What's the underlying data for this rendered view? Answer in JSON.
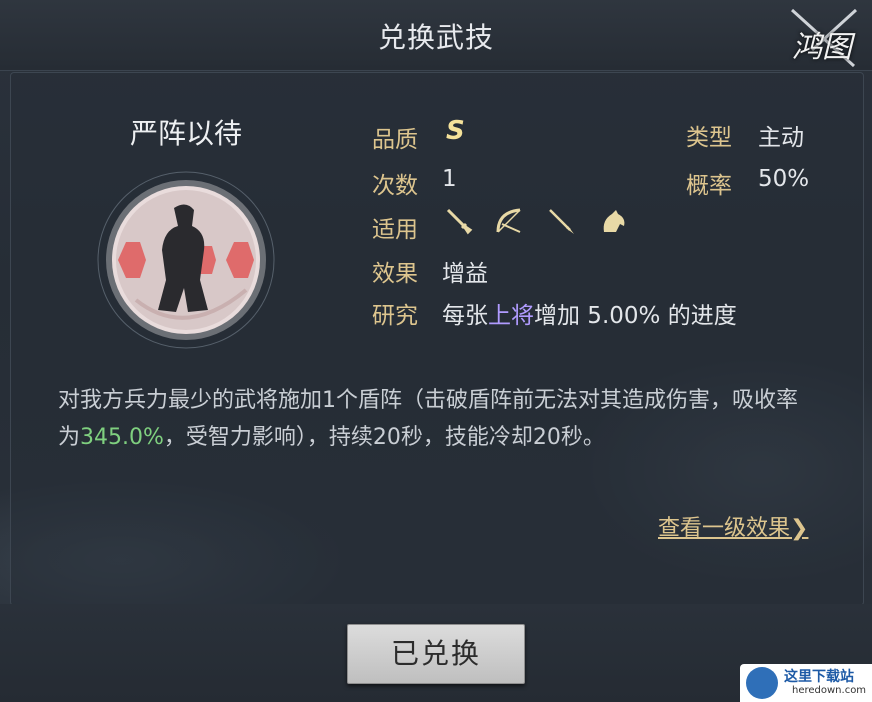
{
  "header": {
    "title": "兑换武技",
    "logo_text": "鸿图"
  },
  "skill": {
    "name": "严阵以待",
    "quality_label": "品质",
    "quality_value": "S",
    "count_label": "次数",
    "count_value": "1",
    "applies_label": "适用",
    "applies_icons": [
      "sword-icon",
      "bow-icon",
      "spear-icon",
      "horse-icon"
    ],
    "effect_label": "效果",
    "effect_value": "增益",
    "type_label": "类型",
    "type_value": "主动",
    "rate_label": "概率",
    "rate_value": "50%",
    "research_label": "研究",
    "research_prefix": "每张",
    "research_highlight": "上将",
    "research_suffix": "增加 5.00% 的进度"
  },
  "description": {
    "part1": "对我方兵力最少的武将施加1个盾阵（击破盾阵前无法对其造成伤害，吸收率为",
    "highlight": "345.0%",
    "part2": "，受智力影响），持续20秒，技能冷却20秒。"
  },
  "links": {
    "more_effect": "查看一级效果❯"
  },
  "footer": {
    "button_label": "已兑换"
  },
  "watermark": {
    "main": "这里下载站",
    "sub": "heredown.com"
  },
  "colors": {
    "label_gold": "#ddc58e",
    "highlight_purple": "#b09bff",
    "highlight_green": "#7fd07f",
    "button_gray": "#cfcfcf"
  }
}
